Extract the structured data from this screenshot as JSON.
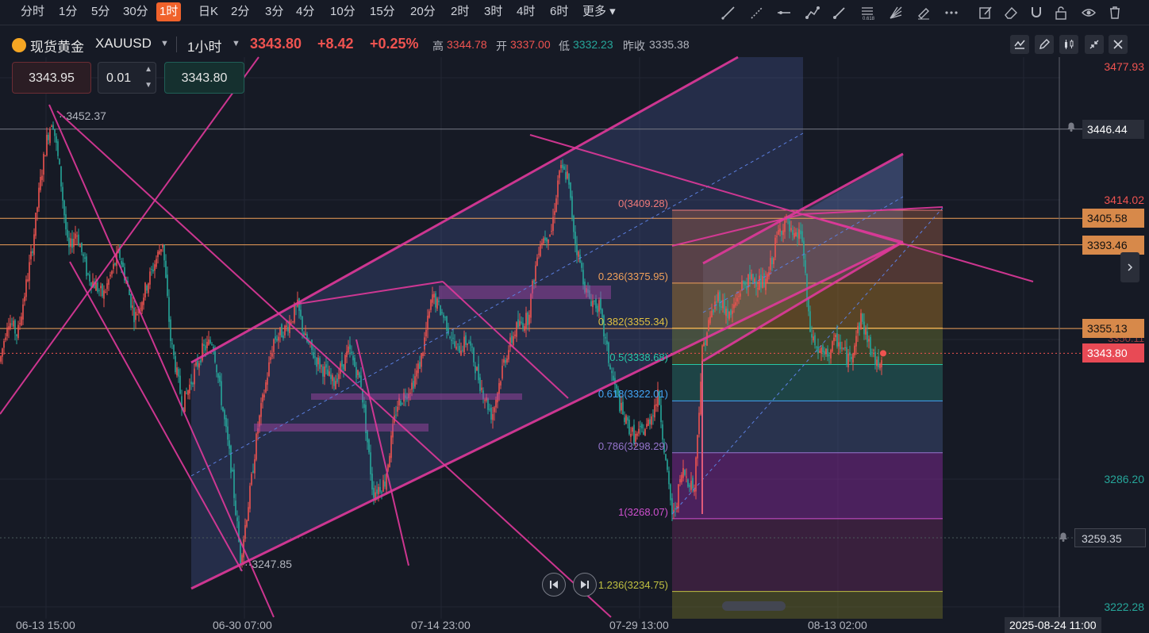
{
  "toolbar": {
    "timeframes": [
      "分时",
      "1分",
      "5分",
      "30分",
      "1时",
      "日K",
      "2分",
      "3分",
      "4分",
      "10分",
      "15分",
      "20分",
      "2时",
      "3时",
      "4时",
      "6时",
      "更多"
    ],
    "active": "1时",
    "tools": [
      "trend-line-icon",
      "ray-line-icon",
      "horizontal-line-icon",
      "polyline-icon",
      "brush-icon",
      "fib-retracement-icon",
      "fib-fan-icon",
      "highlighter-icon",
      "more-dots-icon",
      "edit-icon",
      "eraser-icon",
      "magnet-icon",
      "lock-icon",
      "eye-icon",
      "trash-icon"
    ]
  },
  "header": {
    "name": "现货黄金",
    "code": "XAUUSD",
    "interval": "1小时",
    "price": "3343.80",
    "change": "+8.42",
    "change_pct": "+0.25%",
    "high_label": "高",
    "high": "3344.78",
    "open_label": "开",
    "open": "3337.00",
    "low_label": "低",
    "low": "3332.23",
    "prev_label": "昨收",
    "prev": "3335.38",
    "buttons": [
      "indicator-icon",
      "pencil-icon",
      "candles-icon",
      "collapse-icon",
      "close-icon"
    ]
  },
  "order": {
    "sell": "3343.95",
    "qty": "0.01",
    "buy": "3343.80"
  },
  "colors": {
    "up": "#ef5350",
    "down": "#26a69a",
    "channel": "#e0399b",
    "fib_orange": "#f0a05a"
  },
  "chart_data": {
    "type": "candlestick",
    "title": "XAUUSD 1小时",
    "x_ticks": [
      "06-13 15:00",
      "06-30 07:00",
      "07-14 23:00",
      "07-29 13:00",
      "08-13 02:00"
    ],
    "y_ticks": [
      "3477.93",
      "3414.02",
      "3286.20",
      "3222.28"
    ],
    "horizontal_lines": [
      {
        "price": "3446.44",
        "kind": "alert"
      },
      {
        "price": "3405.58",
        "kind": "level"
      },
      {
        "price": "3393.46",
        "kind": "level"
      },
      {
        "price": "3355.13",
        "kind": "level"
      },
      {
        "price": "3343.80",
        "kind": "last"
      },
      {
        "price": "3259.35",
        "kind": "alert"
      }
    ],
    "covered_tick": "3350.11",
    "annotations": [
      {
        "text": "3452.37"
      },
      {
        "text": "3247.85"
      }
    ],
    "fibonacci": [
      {
        "ratio": "0",
        "price": "3409.28"
      },
      {
        "ratio": "0.236",
        "price": "3375.95"
      },
      {
        "ratio": "0.382",
        "price": "3355.34"
      },
      {
        "ratio": "0.5",
        "price": "3338.68"
      },
      {
        "ratio": "0.618",
        "price": "3322.01"
      },
      {
        "ratio": "0.786",
        "price": "3298.29"
      },
      {
        "ratio": "1",
        "price": "3268.07"
      },
      {
        "ratio": "1.236",
        "price": "3234.75"
      }
    ],
    "cursor_time": "2025-08-24 11:00",
    "price_path": [
      [
        0,
        3340
      ],
      [
        10,
        3360
      ],
      [
        22,
        3352
      ],
      [
        40,
        3390
      ],
      [
        50,
        3420
      ],
      [
        58,
        3440
      ],
      [
        66,
        3452
      ],
      [
        76,
        3425
      ],
      [
        86,
        3390
      ],
      [
        96,
        3400
      ],
      [
        110,
        3380
      ],
      [
        130,
        3370
      ],
      [
        150,
        3390
      ],
      [
        170,
        3360
      ],
      [
        190,
        3380
      ],
      [
        205,
        3395
      ],
      [
        215,
        3350
      ],
      [
        230,
        3320
      ],
      [
        240,
        3330
      ],
      [
        255,
        3345
      ],
      [
        268,
        3350
      ],
      [
        280,
        3320
      ],
      [
        292,
        3290
      ],
      [
        303,
        3250
      ],
      [
        315,
        3280
      ],
      [
        325,
        3310
      ],
      [
        345,
        3350
      ],
      [
        360,
        3355
      ],
      [
        375,
        3365
      ],
      [
        385,
        3350
      ],
      [
        400,
        3340
      ],
      [
        420,
        3330
      ],
      [
        440,
        3345
      ],
      [
        455,
        3330
      ],
      [
        470,
        3280
      ],
      [
        485,
        3285
      ],
      [
        500,
        3320
      ],
      [
        520,
        3330
      ],
      [
        530,
        3340
      ],
      [
        545,
        3370
      ],
      [
        560,
        3360
      ],
      [
        575,
        3345
      ],
      [
        590,
        3350
      ],
      [
        605,
        3330
      ],
      [
        620,
        3315
      ],
      [
        635,
        3340
      ],
      [
        650,
        3355
      ],
      [
        665,
        3360
      ],
      [
        680,
        3395
      ],
      [
        695,
        3400
      ],
      [
        705,
        3428
      ],
      [
        715,
        3425
      ],
      [
        725,
        3395
      ],
      [
        740,
        3370
      ],
      [
        755,
        3365
      ],
      [
        770,
        3335
      ],
      [
        785,
        3315
      ],
      [
        800,
        3305
      ],
      [
        815,
        3310
      ],
      [
        830,
        3325
      ],
      [
        840,
        3290
      ],
      [
        848,
        3268
      ],
      [
        860,
        3290
      ],
      [
        875,
        3282
      ],
      [
        885,
        3345
      ],
      [
        895,
        3360
      ],
      [
        905,
        3370
      ],
      [
        920,
        3360
      ],
      [
        935,
        3375
      ],
      [
        950,
        3378
      ],
      [
        965,
        3375
      ],
      [
        980,
        3398
      ],
      [
        990,
        3405
      ],
      [
        1000,
        3395
      ],
      [
        1010,
        3400
      ],
      [
        1020,
        3355
      ],
      [
        1030,
        3345
      ],
      [
        1040,
        3342
      ],
      [
        1055,
        3350
      ],
      [
        1070,
        3340
      ],
      [
        1085,
        3360
      ],
      [
        1095,
        3348
      ],
      [
        1105,
        3338
      ],
      [
        1112,
        3343.8
      ]
    ]
  },
  "navigation": {
    "prev": "skip-back-icon",
    "next": "skip-forward-icon",
    "expand": "chevron-right-icon"
  }
}
